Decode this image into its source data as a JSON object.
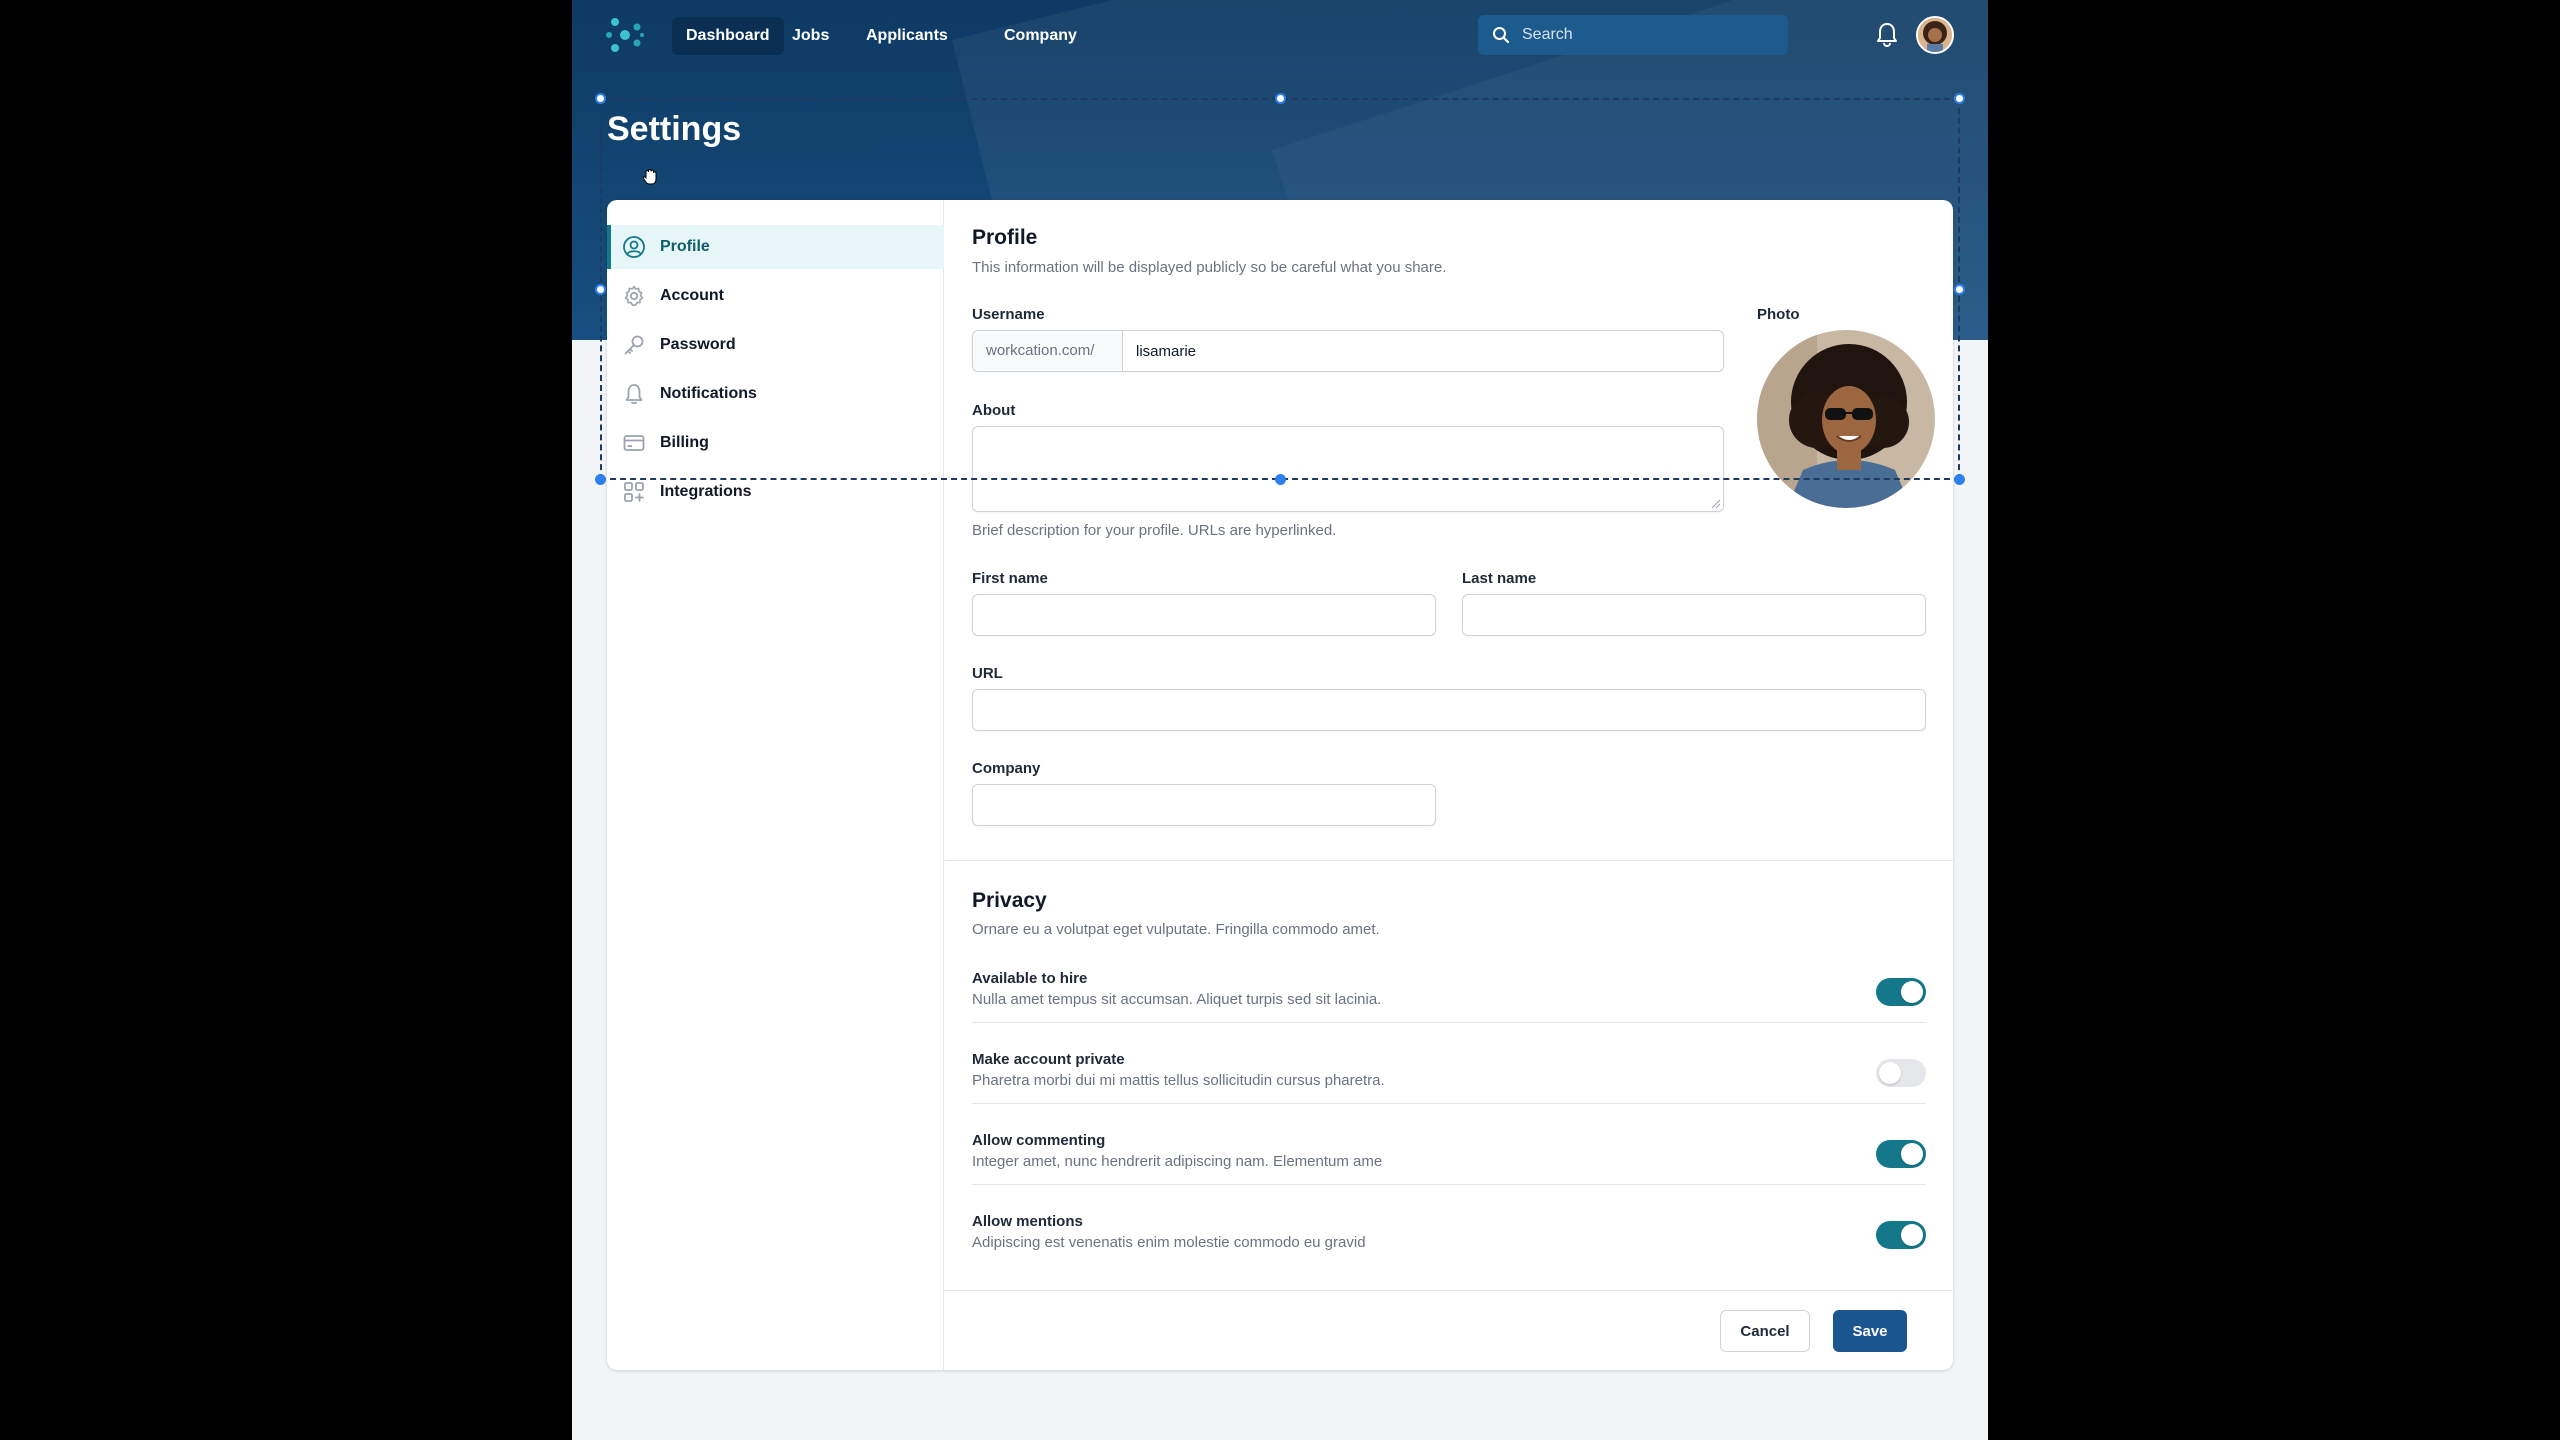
{
  "nav": {
    "links": [
      "Dashboard",
      "Jobs",
      "Applicants",
      "Company"
    ],
    "search_placeholder": "Search"
  },
  "page_title": "Settings",
  "sidebar": {
    "items": [
      {
        "label": "Profile",
        "icon": "user-circle-icon"
      },
      {
        "label": "Account",
        "icon": "gear-icon"
      },
      {
        "label": "Password",
        "icon": "key-icon"
      },
      {
        "label": "Notifications",
        "icon": "bell-icon"
      },
      {
        "label": "Billing",
        "icon": "credit-card-icon"
      },
      {
        "label": "Integrations",
        "icon": "apps-icon"
      }
    ]
  },
  "profile": {
    "title": "Profile",
    "description": "This information will be displayed publicly so be careful what you share.",
    "username_label": "Username",
    "username_prefix": "workcation.com/",
    "username_value": "lisamarie",
    "photo_label": "Photo",
    "about_label": "About",
    "about_value": "",
    "about_help": "Brief description for your profile. URLs are hyperlinked.",
    "first_name_label": "First name",
    "last_name_label": "Last name",
    "url_label": "URL",
    "company_label": "Company"
  },
  "privacy": {
    "title": "Privacy",
    "description": "Ornare eu a volutpat eget vulputate. Fringilla commodo amet.",
    "items": [
      {
        "title": "Available to hire",
        "description": "Nulla amet tempus sit accumsan. Aliquet turpis sed sit lacinia.",
        "enabled": true
      },
      {
        "title": "Make account private",
        "description": "Pharetra morbi dui mi mattis tellus sollicitudin cursus pharetra.",
        "enabled": false
      },
      {
        "title": "Allow commenting",
        "description": "Integer amet, nunc hendrerit adipiscing nam. Elementum ame",
        "enabled": true
      },
      {
        "title": "Allow mentions",
        "description": "Adipiscing est venenatis enim molestie commodo eu gravid",
        "enabled": true
      }
    ]
  },
  "actions": {
    "cancel": "Cancel",
    "save": "Save"
  },
  "colors": {
    "accent": "#14788a",
    "primary": "#1c5690",
    "header": "#0e3a63"
  }
}
